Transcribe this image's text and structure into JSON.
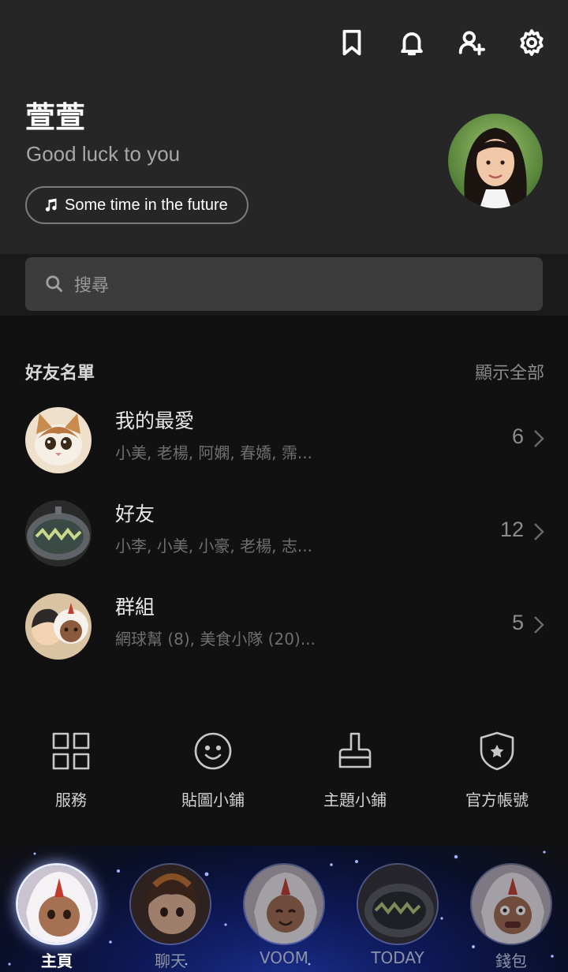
{
  "header": {
    "icons": [
      "bookmark-icon",
      "bell-icon",
      "add-friend-icon",
      "settings-icon"
    ],
    "profile": {
      "name": "萱萱",
      "status": "Good luck to you",
      "music": "Some time in the future"
    }
  },
  "search": {
    "placeholder": "搜尋"
  },
  "friends": {
    "title": "好友名單",
    "show_all": "顯示全部",
    "rows": [
      {
        "title": "我的最愛",
        "subtitle": "小美, 老楊, 阿嫻, 春嬌, 霈...",
        "count": "6"
      },
      {
        "title": "好友",
        "subtitle": "小李, 小美, 小豪, 老楊, 志...",
        "count": "12"
      },
      {
        "title": "群組",
        "subtitle": "網球幫 (8), 美食小隊 (20)...",
        "count": "5"
      }
    ]
  },
  "shortcuts": [
    {
      "label": "服務",
      "icon": "grid-icon"
    },
    {
      "label": "貼圖小鋪",
      "icon": "smiley-icon"
    },
    {
      "label": "主題小鋪",
      "icon": "brush-icon"
    },
    {
      "label": "官方帳號",
      "icon": "shield-star-icon"
    }
  ],
  "tabs": [
    {
      "label": "主頁",
      "active": true
    },
    {
      "label": "聊天",
      "active": false
    },
    {
      "label": "VOOM",
      "active": false
    },
    {
      "label": "TODAY",
      "active": false
    },
    {
      "label": "錢包",
      "active": false
    }
  ],
  "colors": {
    "header_bg": "#262626",
    "body_bg": "#111111",
    "search_bg": "#3c3c3c",
    "tab_glow": "#1b2f8f"
  }
}
